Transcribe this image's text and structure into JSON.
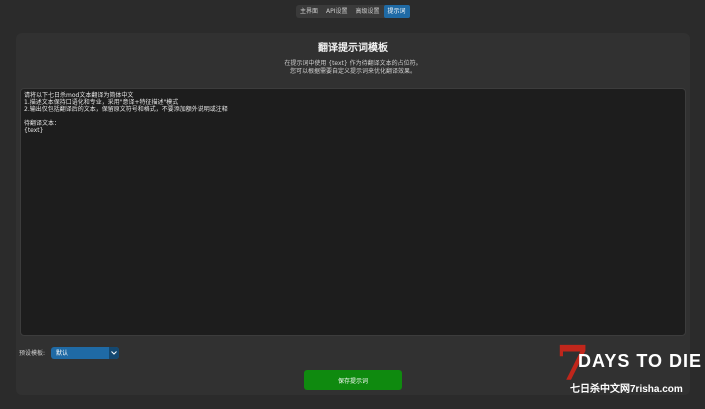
{
  "tabs": [
    {
      "label": "主界面",
      "active": false
    },
    {
      "label": "API设置",
      "active": false
    },
    {
      "label": "高级设置",
      "active": false
    },
    {
      "label": "提示词",
      "active": true
    }
  ],
  "panel": {
    "title": "翻译提示词模板",
    "desc_line1": "在提示词中使用 {text} 作为待翻译文本的占位符。",
    "desc_line2": "您可以根据需要自定义提示词来优化翻译效果。"
  },
  "editor": {
    "content": "请将以下七日杀mod文本翻译为简体中文\n1.描述文本保持口语化和专业，采用\"意译+特征描述\"模式\n2.输出仅包括翻译后的文本，保留原文符号和格式，不要添加额外说明或注释\n\n待翻译文本：\n{text}"
  },
  "preset": {
    "label": "预设模板:",
    "value": "默认"
  },
  "save_label": "保存提示词",
  "watermark": {
    "seven": "7",
    "title": "DAYS TO DIE",
    "site": "七日杀中文网7risha.com"
  },
  "colors": {
    "accent": "#1f6aa5",
    "save": "#0f8a0f",
    "logo_red": "#c0261b"
  }
}
